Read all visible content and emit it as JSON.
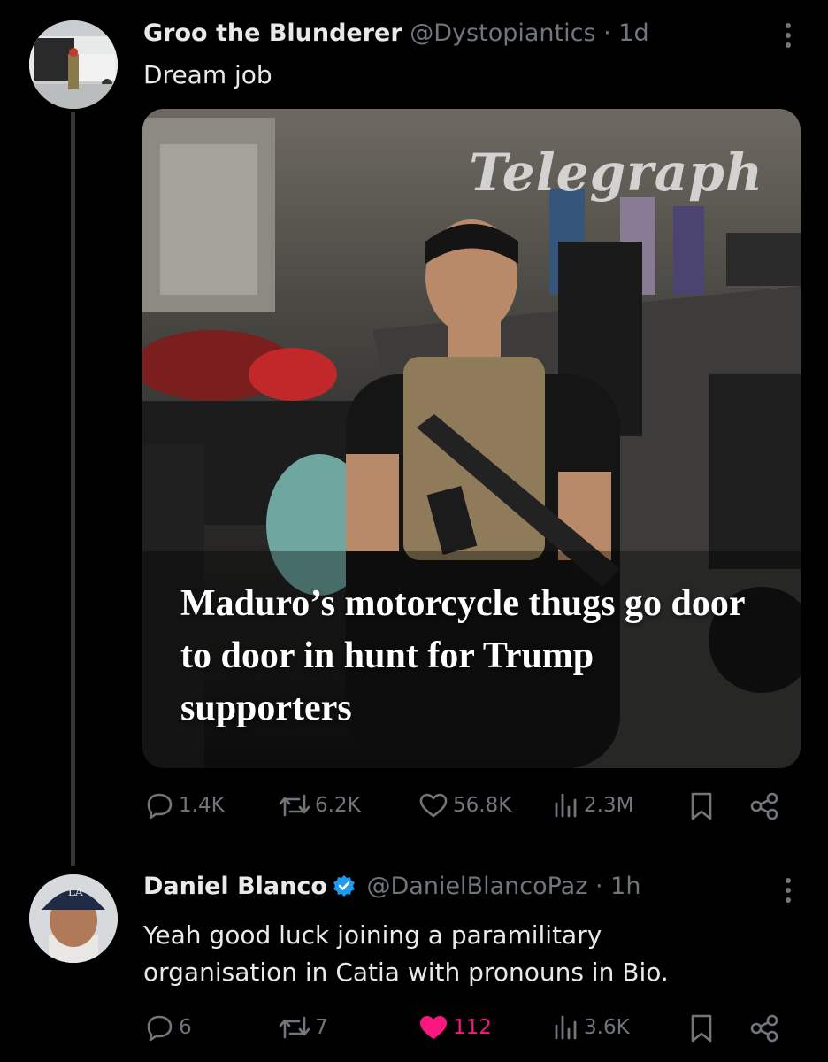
{
  "tweet": {
    "author_name": "Groo the Blunderer",
    "handle": "@Dystopiantics",
    "time": "· 1d",
    "text": "Dream job",
    "media": {
      "masthead": "Telegraph",
      "headline": "Maduro’s motorcycle thugs go door to door in hunt for Trump supporters"
    },
    "stats": {
      "replies": "1.4K",
      "reposts": "6.2K",
      "likes": "56.8K",
      "views": "2.3M"
    }
  },
  "reply": {
    "author_name": "Daniel Blanco",
    "handle": "@DanielBlancoPaz",
    "time": "· 1h",
    "text": "Yeah good luck joining a paramilitary organisation in Catia with pronouns in Bio.",
    "stats": {
      "replies": "6",
      "reposts": "7",
      "likes": "112",
      "views": "3.6K"
    },
    "liked": true
  },
  "icons": [
    "more-icon",
    "reply-icon",
    "repost-icon",
    "like-icon",
    "views-icon",
    "bookmark-icon",
    "share-icon",
    "verified-icon"
  ],
  "colors": {
    "background": "#000000",
    "muted": "#71767b",
    "text": "#e7e9ea",
    "like": "#f91880",
    "verified": "#1d9bf0"
  }
}
